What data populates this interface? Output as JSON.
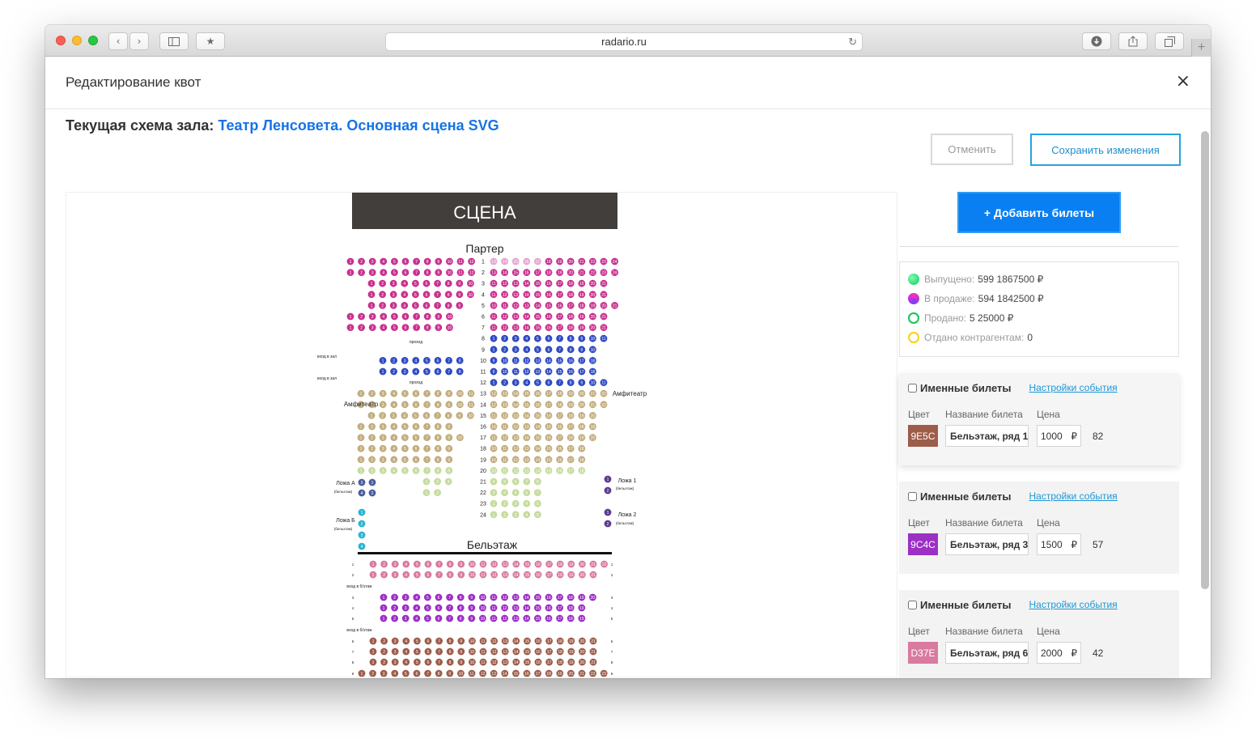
{
  "browser": {
    "url": "radario.ru"
  },
  "modal": {
    "title": "Редактирование квот",
    "close_label": "×"
  },
  "scheme": {
    "label": "Текущая схема зала:",
    "name": "Театр Ленсовета. Основная сцена SVG"
  },
  "actions": {
    "cancel_label": "Отменить",
    "save_label": "Сохранить изменения",
    "add_tickets_label": "+ Добавить билеты"
  },
  "stats": [
    {
      "label": "Выпущено:",
      "value": "599 1867500 ₽",
      "icon": "gradient-green-dot"
    },
    {
      "label": "В продаже:",
      "value": "594 1842500 ₽",
      "icon": "gradient-magenta-dot"
    },
    {
      "label": "Продано:",
      "value": "5 25000 ₽",
      "icon": "green-ring"
    },
    {
      "label": "Отдано контрагентам:",
      "value": "0",
      "icon": "yellow-ring"
    }
  ],
  "ticket_groups": [
    {
      "checkbox_label": "Именные билеты",
      "settings_link": "Настройки события",
      "color_label": "Цвет",
      "name_label": "Название билета",
      "price_label": "Цена",
      "color_code": "9E5C",
      "color_hex": "#9e5c4a",
      "name": "Бельэтаж, ряд 1",
      "price": "1000",
      "currency": "₽",
      "count": "82"
    },
    {
      "checkbox_label": "Именные билеты",
      "settings_link": "Настройки события",
      "color_label": "Цвет",
      "name_label": "Название билета",
      "price_label": "Цена",
      "color_code": "9C4C",
      "color_hex": "#9c2fc4",
      "name": "Бельэтаж, ряд 3",
      "price": "1500",
      "currency": "₽",
      "count": "57"
    },
    {
      "checkbox_label": "Именные билеты",
      "settings_link": "Настройки события",
      "color_label": "Цвет",
      "name_label": "Название билета",
      "price_label": "Цена",
      "color_code": "D37E",
      "color_hex": "#d97aa0",
      "name": "Бельэтаж, ряд 6",
      "price": "2000",
      "currency": "₽",
      "count": "42"
    }
  ],
  "hall": {
    "stage_label": "СЦЕНА",
    "parter_label": "Партер",
    "beletazh_label": "Бельэтаж",
    "amphitheater_label": "Амфитеатр",
    "entrance_label": "вход в зал",
    "passage_label": "проход",
    "beletazh_entrance_label": "вход в б/этаж",
    "box_a_label": "Ложа А",
    "box_b_label": "Ложа Б",
    "box_1_label": "Ложа 1",
    "box_2_label": "Ложа 2",
    "box_sub_label": "(бельэтаж)",
    "colors": {
      "parter": "#c8318f",
      "parter_pale": "#e6a6cf",
      "blue": "#2f4bc4",
      "tan": "#c2ad7e",
      "lightgreen": "#c5dc9e",
      "box_navy": "#4a5f9e",
      "box_cyan": "#28b4d3",
      "box_purple": "#5d3a8f",
      "bel_pink": "#d97aa0",
      "bel_purple": "#9c2fc4",
      "bel_brown": "#9e5c4a",
      "stage_bg": "#423e3c"
    }
  }
}
